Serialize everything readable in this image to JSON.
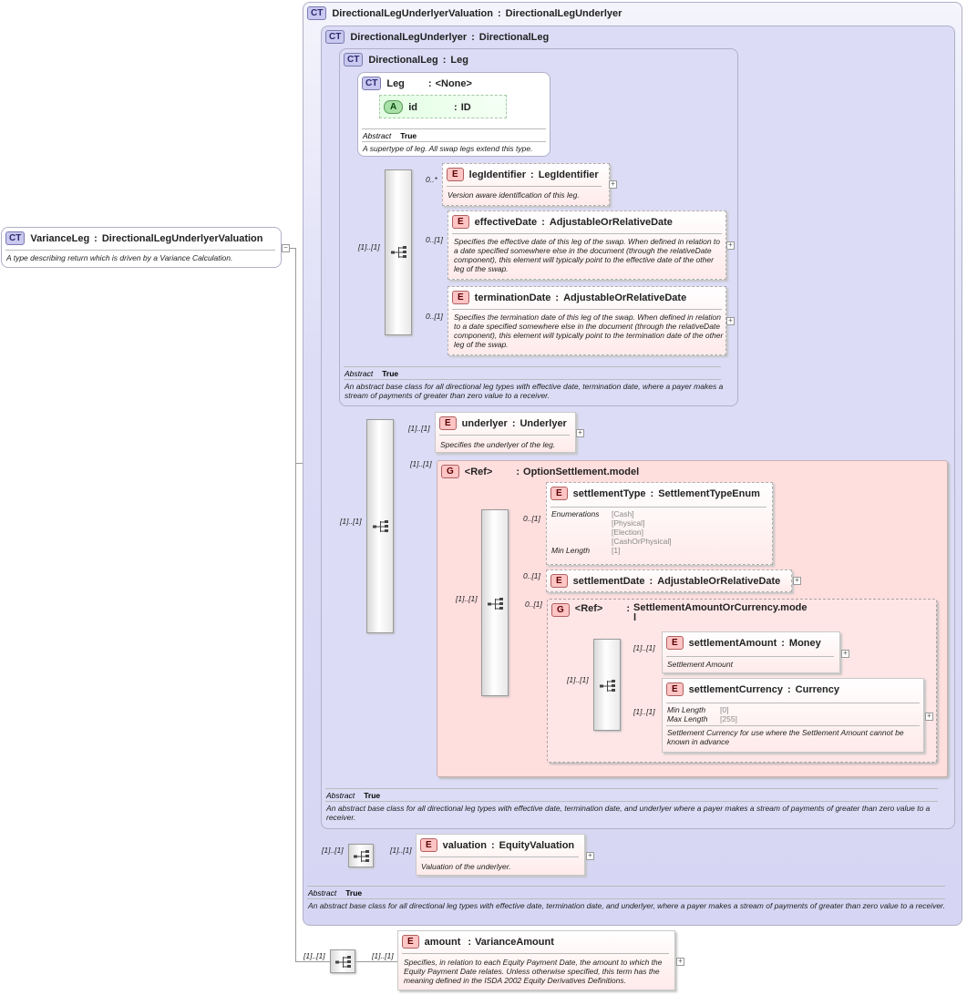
{
  "root": {
    "badge": "CT",
    "name": "VarianceLeg",
    "sep": ":",
    "type": "DirectionalLegUnderlyerValuation",
    "desc": "A type describing return which is driven by a Variance Calculation."
  },
  "dluv": {
    "badge": "CT",
    "name": "DirectionalLegUnderlyerValuation",
    "sep": ":",
    "type": "DirectionalLegUnderlyer",
    "abstract_label": "Abstract",
    "abstract_value": "True",
    "desc": "An abstract base class for all directional leg types with effective date, termination date, and underlyer, where a payer makes a stream of payments of greater than zero value to a receiver."
  },
  "dlu": {
    "badge": "CT",
    "name": "DirectionalLegUnderlyer",
    "sep": ":",
    "type": "DirectionalLeg",
    "abstract_label": "Abstract",
    "abstract_value": "True",
    "desc": "An abstract base class for all directional leg types with effective date, termination date, and underlyer where a payer makes a stream of payments of greater than zero value to a receiver."
  },
  "dl": {
    "badge": "CT",
    "name": "DirectionalLeg",
    "sep": ":",
    "type": "Leg",
    "abstract_label": "Abstract",
    "abstract_value": "True",
    "desc": "An abstract base class for all directional leg types with effective date, termination date, where a payer makes a stream of payments of greater than zero value to a receiver."
  },
  "leg": {
    "badge": "CT",
    "name": "Leg",
    "sep": ":",
    "type": "<None>",
    "attr": {
      "badge": "A",
      "name": "id",
      "sep": ":",
      "type": "ID"
    },
    "abstract_label": "Abstract",
    "abstract_value": "True",
    "desc": "A supertype of leg. All swap legs extend this type."
  },
  "legIdentifier": {
    "badge": "E",
    "name": "legIdentifier",
    "sep": ":",
    "type": "LegIdentifier",
    "card": "0..*",
    "desc": "Version aware identification of this leg."
  },
  "effectiveDate": {
    "badge": "E",
    "name": "effectiveDate",
    "sep": ":",
    "type": "AdjustableOrRelativeDate",
    "card": "0..[1]",
    "desc": "Specifies the effective date of this leg of the swap. When defined in relation to a date specified somewhere else in the document (through the relativeDate component), this element will typically point to the effective date of the other leg of the swap."
  },
  "terminationDate": {
    "badge": "E",
    "name": "terminationDate",
    "sep": ":",
    "type": "AdjustableOrRelativeDate",
    "card": "0..[1]",
    "desc": "Specifies the termination date of this leg of the swap. When defined in relation to a date specified somewhere else in the document (through the relativeDate component), this element will typically point to the termination date of the other leg of the swap."
  },
  "dl_seq_card": "[1]..[1]",
  "dlu_seq_card": "[1]..[1]",
  "underlyer": {
    "badge": "E",
    "name": "underlyer",
    "sep": ":",
    "type": "Underlyer",
    "card": "[1]..[1]",
    "desc": "Specifies the underlyer of the leg."
  },
  "optset": {
    "badge": "G",
    "ref": "<Ref>",
    "sep": ":",
    "type": "OptionSettlement.model",
    "card": "[1]..[1]",
    "seq_card": "[1]..[1]"
  },
  "settlementType": {
    "badge": "E",
    "name": "settlementType",
    "sep": ":",
    "type": "SettlementTypeEnum",
    "card": "0..[1]",
    "facets": [
      {
        "key": "Enumerations",
        "values": [
          "[Cash]",
          "[Physical]",
          "[Election]",
          "[CashOrPhysical]"
        ]
      },
      {
        "key": "Min Length",
        "values": [
          "[1]"
        ]
      }
    ]
  },
  "settlementDate": {
    "badge": "E",
    "name": "settlementDate",
    "sep": ":",
    "type": "AdjustableOrRelativeDate",
    "card": "0..[1]"
  },
  "samc": {
    "badge": "G",
    "ref": "<Ref>",
    "sep": ":",
    "type_line1": "SettlementAmountOrCurrency.mode",
    "type_line2": "l",
    "card": "0..[1]",
    "seq_card": "[1]..[1]"
  },
  "settlementAmount": {
    "badge": "E",
    "name": "settlementAmount",
    "sep": ":",
    "type": "Money",
    "card": "[1]..[1]",
    "desc": "Settlement Amount"
  },
  "settlementCurrency": {
    "badge": "E",
    "name": "settlementCurrency",
    "sep": ":",
    "type": "Currency",
    "card": "[1]..[1]",
    "facets": [
      {
        "key": "Min Length",
        "values": [
          "[0]"
        ]
      },
      {
        "key": "Max Length",
        "values": [
          "[255]"
        ]
      }
    ],
    "desc": "Settlement Currency for use where the Settlement Amount cannot be known in advance"
  },
  "valuation": {
    "badge": "E",
    "name": "valuation",
    "sep": ":",
    "type": "EquityValuation",
    "card": "[1]..[1]",
    "seq_card": "[1]..[1]",
    "desc": "Valuation of the underlyer."
  },
  "amount": {
    "badge": "E",
    "name": "amount",
    "sep": ":",
    "type": "VarianceAmount",
    "card": "[1]..[1]",
    "seq_card": "[1]..[1]",
    "desc": "Specifies, in relation to each Equity Payment Date, the amount to which the Equity Payment Date relates. Unless otherwise specified, this term has the meaning defined in the ISDA 2002 Equity Derivatives Definitions."
  },
  "expand_plus": "+",
  "collapse_minus": "−",
  "icons": {
    "ct": "complex-type-icon",
    "sequence": "sequence-compositor-icon",
    "expand": "expand-icon",
    "collapse": "collapse-icon"
  },
  "colors": {
    "complex_bg": "#dcdcf6",
    "group_bg": "#ffdede",
    "element_bg": "#ffeaea",
    "attribute_bg": "#e4ffe4",
    "border": "#b0b0c8"
  }
}
